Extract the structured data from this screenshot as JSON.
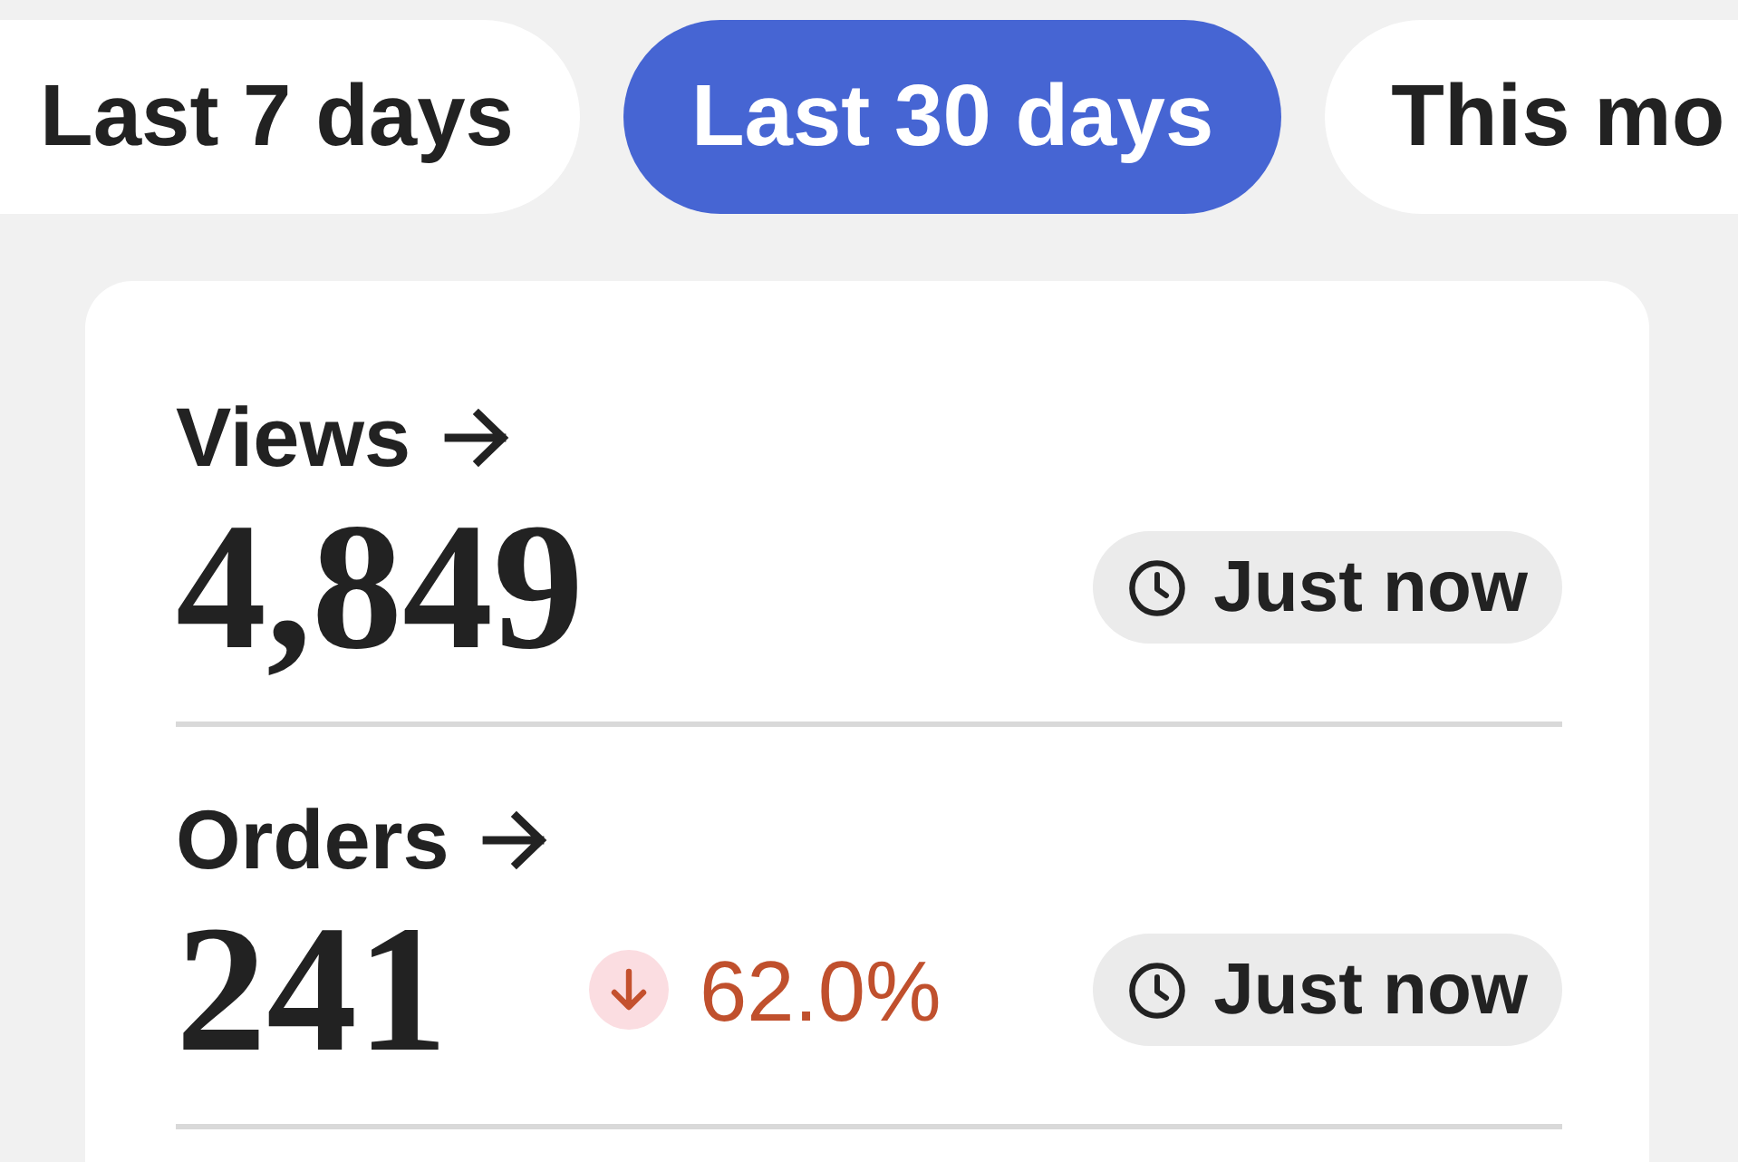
{
  "tabs": [
    {
      "label": "Last 7 days",
      "selected": false
    },
    {
      "label": "Last 30 days",
      "selected": true
    },
    {
      "label": "This mo",
      "selected": false
    }
  ],
  "metrics": [
    {
      "label": "Views",
      "value": "4,849",
      "updated": "Just now"
    },
    {
      "label": "Orders",
      "value": "241",
      "change": {
        "kind": "down",
        "text": "62.0%"
      },
      "updated": "Just now"
    }
  ]
}
